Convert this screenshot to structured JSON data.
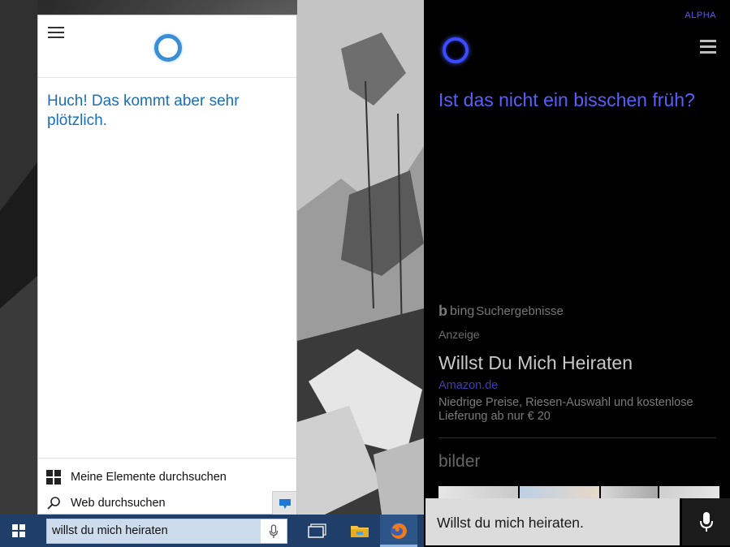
{
  "desktop": {
    "cortana": {
      "response": "Huch! Das kommt aber sehr plötzlich.",
      "footer": {
        "my_stuff_label": "Meine Elemente durchsuchen",
        "web_label": "Web durchsuchen"
      }
    },
    "taskbar": {
      "search_value": "willst du mich heiraten",
      "icons": [
        "windows-logo",
        "microphone",
        "task-view",
        "file-explorer",
        "firefox"
      ]
    },
    "accent_color": "#1b6fb5",
    "taskbar_color": "#1f3f6a"
  },
  "phone": {
    "alpha_label": "ALPHA",
    "response": "Ist das nicht ein bisschen früh?",
    "bing": {
      "brand": "bing",
      "label": "Suchergebnisse"
    },
    "ad": {
      "tag": "Anzeige",
      "title": "Willst Du Mich Heiraten",
      "link": "Amazon.de",
      "description": "Niedrige Preise, Riesen-Auswahl und kostenlose Lieferung ab nur € 20"
    },
    "images_heading": "bilder",
    "query_text": "Willst du mich heiraten.",
    "accent_color": "#5760ff"
  }
}
